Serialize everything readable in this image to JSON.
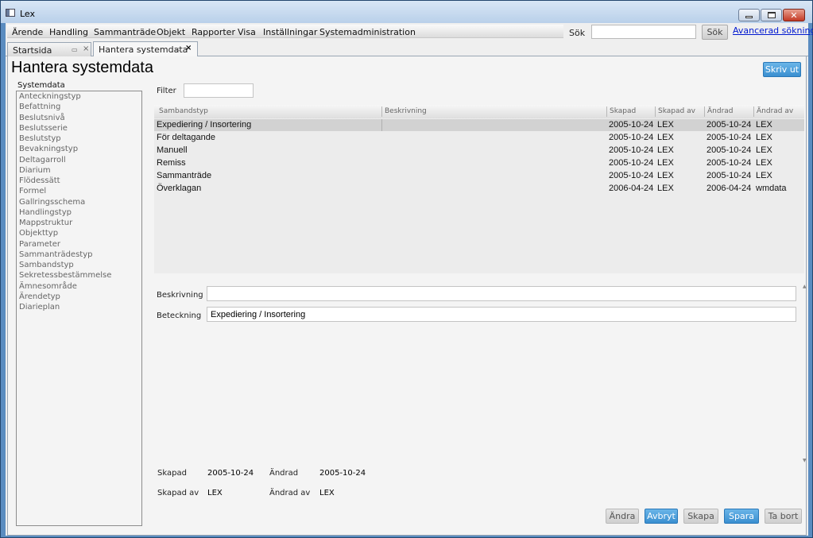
{
  "window": {
    "title": "Lex",
    "close_glyph": "✕"
  },
  "menu": {
    "items": [
      "Ärende",
      "Handling",
      "Sammanträde",
      "Objekt",
      "Rapporter",
      "Visa",
      "Inställningar",
      "Systemadministration"
    ],
    "search_label": "Sök",
    "search_value": "",
    "search_button": "Sök",
    "advanced_link": "Avancerad sökning"
  },
  "tabs": [
    {
      "label": "Startsida",
      "close": "×"
    },
    {
      "label": "Hantera systemdata",
      "close": "×"
    }
  ],
  "page": {
    "title": "Hantera systemdata",
    "print_button": "Skriv ut",
    "systemdata_label": "Systemdata",
    "systemdata_items": [
      "Anteckningstyp",
      "Befattning",
      "Beslutsnivå",
      "Beslutsserie",
      "Beslutstyp",
      "Bevakningstyp",
      "Deltagarroll",
      "Diarium",
      "Flödessätt",
      "Formel",
      "Gallringsschema",
      "Handlingstyp",
      "Mappstruktur",
      "Objekttyp",
      "Parameter",
      "Sammanträdestyp",
      "Sambandstyp",
      "Sekretessbestämmelse",
      "Ämnesområde",
      "Ärendetyp",
      "Diarieplan"
    ],
    "filter_label": "Filter",
    "filter_value": ""
  },
  "table": {
    "columns": [
      "Sambandstyp",
      "Beskrivning",
      "Skapad",
      "Skapad av",
      "Ändrad",
      "Ändrad av"
    ],
    "rows": [
      [
        "Expediering / Insortering",
        "",
        "2005-10-24",
        "LEX",
        "2005-10-24",
        "LEX"
      ],
      [
        "För deltagande",
        "",
        "2005-10-24",
        "LEX",
        "2005-10-24",
        "LEX"
      ],
      [
        "Manuell",
        "",
        "2005-10-24",
        "LEX",
        "2005-10-24",
        "LEX"
      ],
      [
        "Remiss",
        "",
        "2005-10-24",
        "LEX",
        "2005-10-24",
        "LEX"
      ],
      [
        "Sammanträde",
        "",
        "2005-10-24",
        "LEX",
        "2005-10-24",
        "LEX"
      ],
      [
        "Överklagan",
        "",
        "2006-04-24",
        "LEX",
        "2006-04-24",
        "wmdata"
      ]
    ],
    "selected_row": 0
  },
  "detail": {
    "beskrivning_label": "Beskrivning",
    "beskrivning_value": "",
    "beteckning_label": "Beteckning",
    "beteckning_value": "Expediering / Insortering",
    "skapad_label": "Skapad",
    "skapad_value": "2005-10-24",
    "andrad_label": "Ändrad",
    "andrad_value": "2005-10-24",
    "skapad_av_label": "Skapad av",
    "skapad_av_value": "LEX",
    "andrad_av_label": "Ändrad av",
    "andrad_av_value": "LEX"
  },
  "buttons": {
    "andra": "Ändra",
    "avbryt": "Avbryt",
    "skapa": "Skapa",
    "spara": "Spara",
    "ta_bort": "Ta bort"
  },
  "colors": {
    "accent_button": "#3a8fd0",
    "selected_row": "#d2d2d2",
    "link": "#0018d0"
  }
}
